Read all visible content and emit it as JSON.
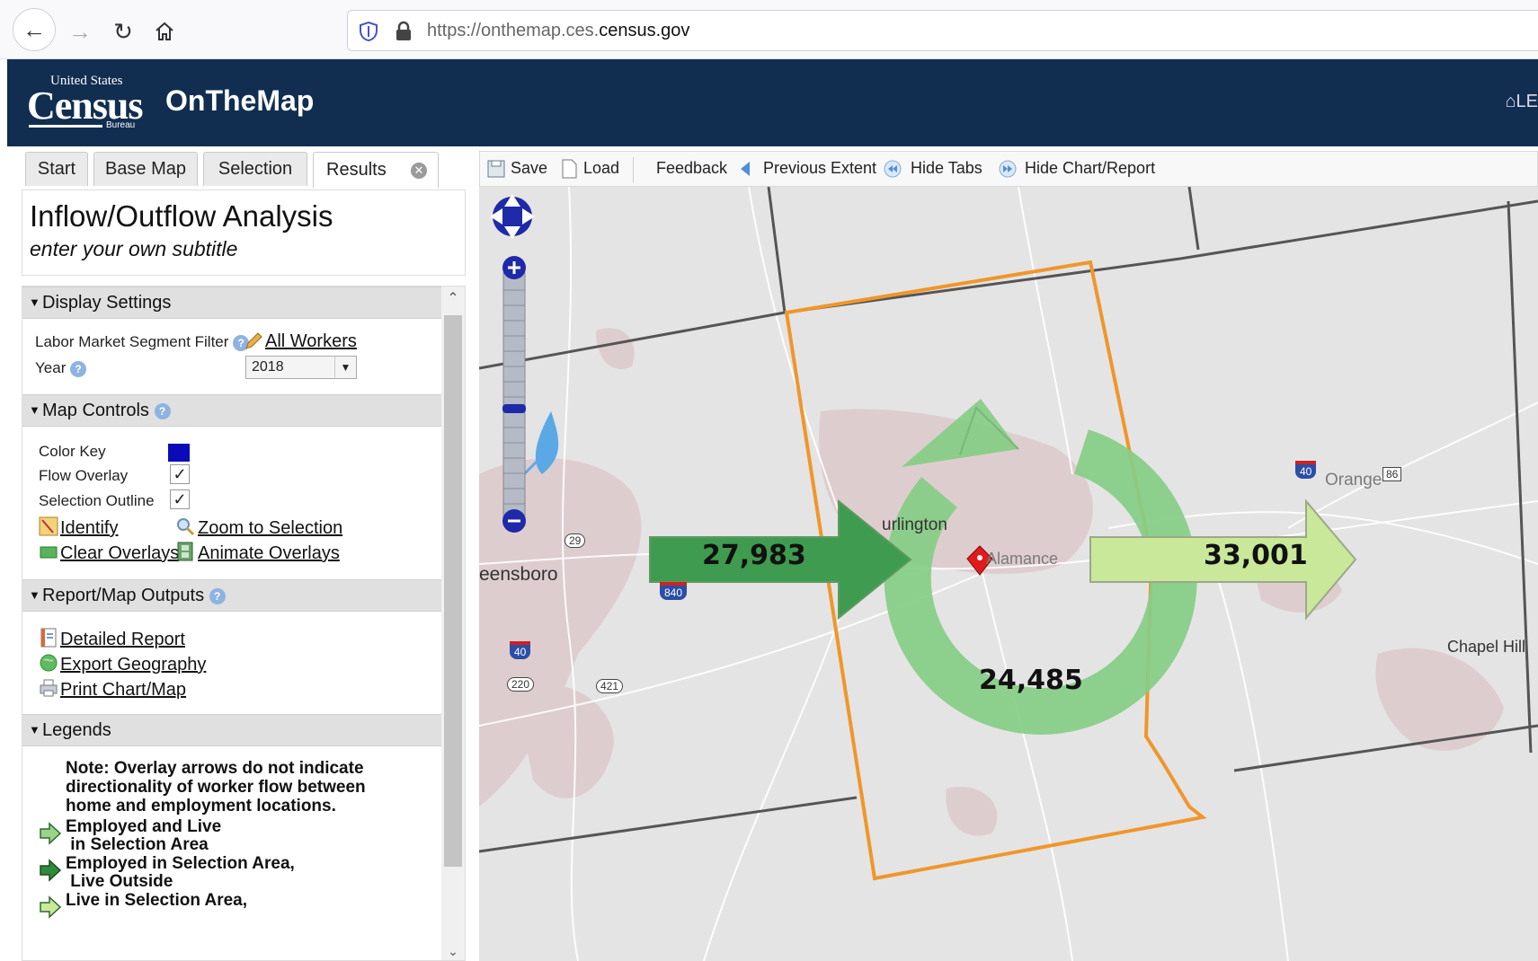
{
  "browser": {
    "url_prefix": "https://onthemap.ces.",
    "url_domain": "census.gov"
  },
  "header": {
    "logo_line1": "United States",
    "logo_word": "Census",
    "logo_line2": "Bureau",
    "app_title": "OnTheMap",
    "right_link": "LE"
  },
  "tabs": [
    "Start",
    "Base Map",
    "Selection",
    "Results"
  ],
  "panel": {
    "title": "Inflow/Outflow Analysis",
    "subtitle": "enter your own subtitle",
    "display_settings": {
      "heading": "Display Settings",
      "segment_label": "Labor Market Segment Filter",
      "segment_value": "All Workers",
      "year_label": "Year",
      "year_value": "2018"
    },
    "map_controls": {
      "heading": "Map Controls",
      "color_key": "Color Key",
      "flow_overlay": "Flow Overlay",
      "selection_outline": "Selection Outline",
      "identify": "Identify",
      "zoom_selection": "Zoom to Selection",
      "clear_overlays": "Clear Overlays",
      "animate_overlays": "Animate Overlays",
      "color_key_color": "#0a0ab8"
    },
    "outputs": {
      "heading": "Report/Map Outputs",
      "detailed_report": "Detailed Report",
      "export_geography": "Export Geography",
      "print_chart": "Print Chart/Map"
    },
    "legends": {
      "heading": "Legends",
      "note": "Note: Overlay arrows do not indicate directionality of worker flow between home and employment locations.",
      "item1": "Employed and Live\n in Selection Area",
      "item2": "Employed in Selection Area,\n Live Outside",
      "item3": "Live in Selection Area,"
    }
  },
  "toolbar": {
    "save": "Save",
    "load": "Load",
    "feedback": "Feedback",
    "previous_extent": "Previous Extent",
    "hide_tabs": "Hide Tabs",
    "hide_chart": "Hide Chart/Report"
  },
  "map": {
    "inflow": "27,983",
    "outflow": "33,001",
    "internal": "24,485",
    "labels": {
      "burlington": "urlington",
      "greensboro": "eensboro",
      "alamance": "Alamance",
      "orange": "Orange",
      "chapel_hill": "Chapel Hill"
    },
    "shields": {
      "r29": "29",
      "i840": "840",
      "i40a": "40",
      "r220": "220",
      "r421": "421",
      "i40b": "40",
      "r86": "86"
    },
    "colors": {
      "inflow_arrow": "#3f9b4f",
      "outflow_arrow": "#c9e89a",
      "internal_ring": "#86cd86",
      "selection_outline": "#f0962a"
    }
  }
}
